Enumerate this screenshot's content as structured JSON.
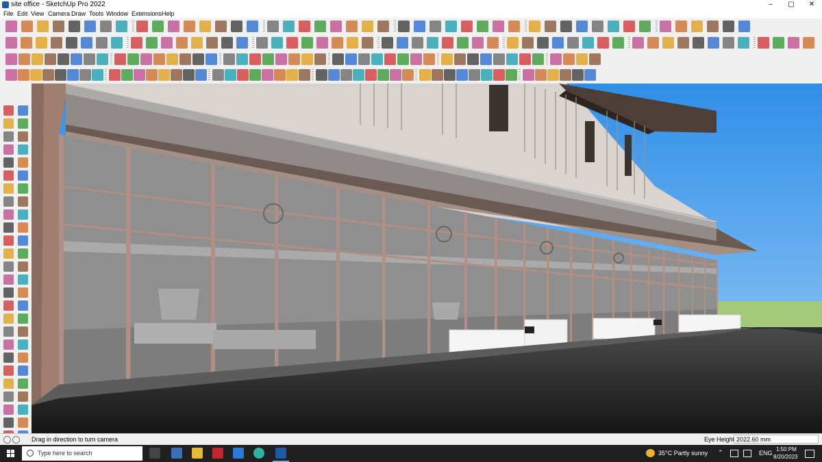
{
  "window": {
    "title": "site office - SketchUp Pro 2022",
    "controls": {
      "minimize": "–",
      "maximize": "▢",
      "close": "✕"
    }
  },
  "menu": {
    "items": [
      "File",
      "Edit",
      "View",
      "Camera",
      "Draw",
      "Tools",
      "Window",
      "Extensions",
      "Help"
    ]
  },
  "statusbar": {
    "message": "Drag in direction to turn camera",
    "vcb_label": "Eye Height",
    "vcb_value": "2022.60 mm"
  },
  "taskbar": {
    "search_placeholder": "Type here to search",
    "weather": "35°C  Partly sunny",
    "language": "ENG",
    "time": "1:50 PM",
    "date": "8/20/2023"
  },
  "colors": {
    "accent": "#1f5aa6",
    "sky": "#4ea8f0",
    "grass": "#a3c97b",
    "floor": "#2a2a2a",
    "glass": "#8f8f8f",
    "mullion": "#b08f84"
  },
  "icons": [
    "zoom-icon",
    "select-icon",
    "eraser-icon",
    "pencil-icon",
    "orbit-icon",
    "pan-icon",
    "walk-icon",
    "look-around-icon",
    "position-camera-icon",
    "tape-measure-icon",
    "protractor-icon",
    "paint-bucket-icon",
    "move-icon",
    "rotate-icon",
    "scale-icon",
    "push-pull-icon",
    "offset-icon",
    "follow-me-icon",
    "rectangle-icon",
    "circle-icon",
    "polygon-icon",
    "arc-icon",
    "line-icon",
    "text-icon",
    "dimension-icon",
    "axes-icon",
    "section-plane-icon",
    "zoom-extents-icon"
  ]
}
